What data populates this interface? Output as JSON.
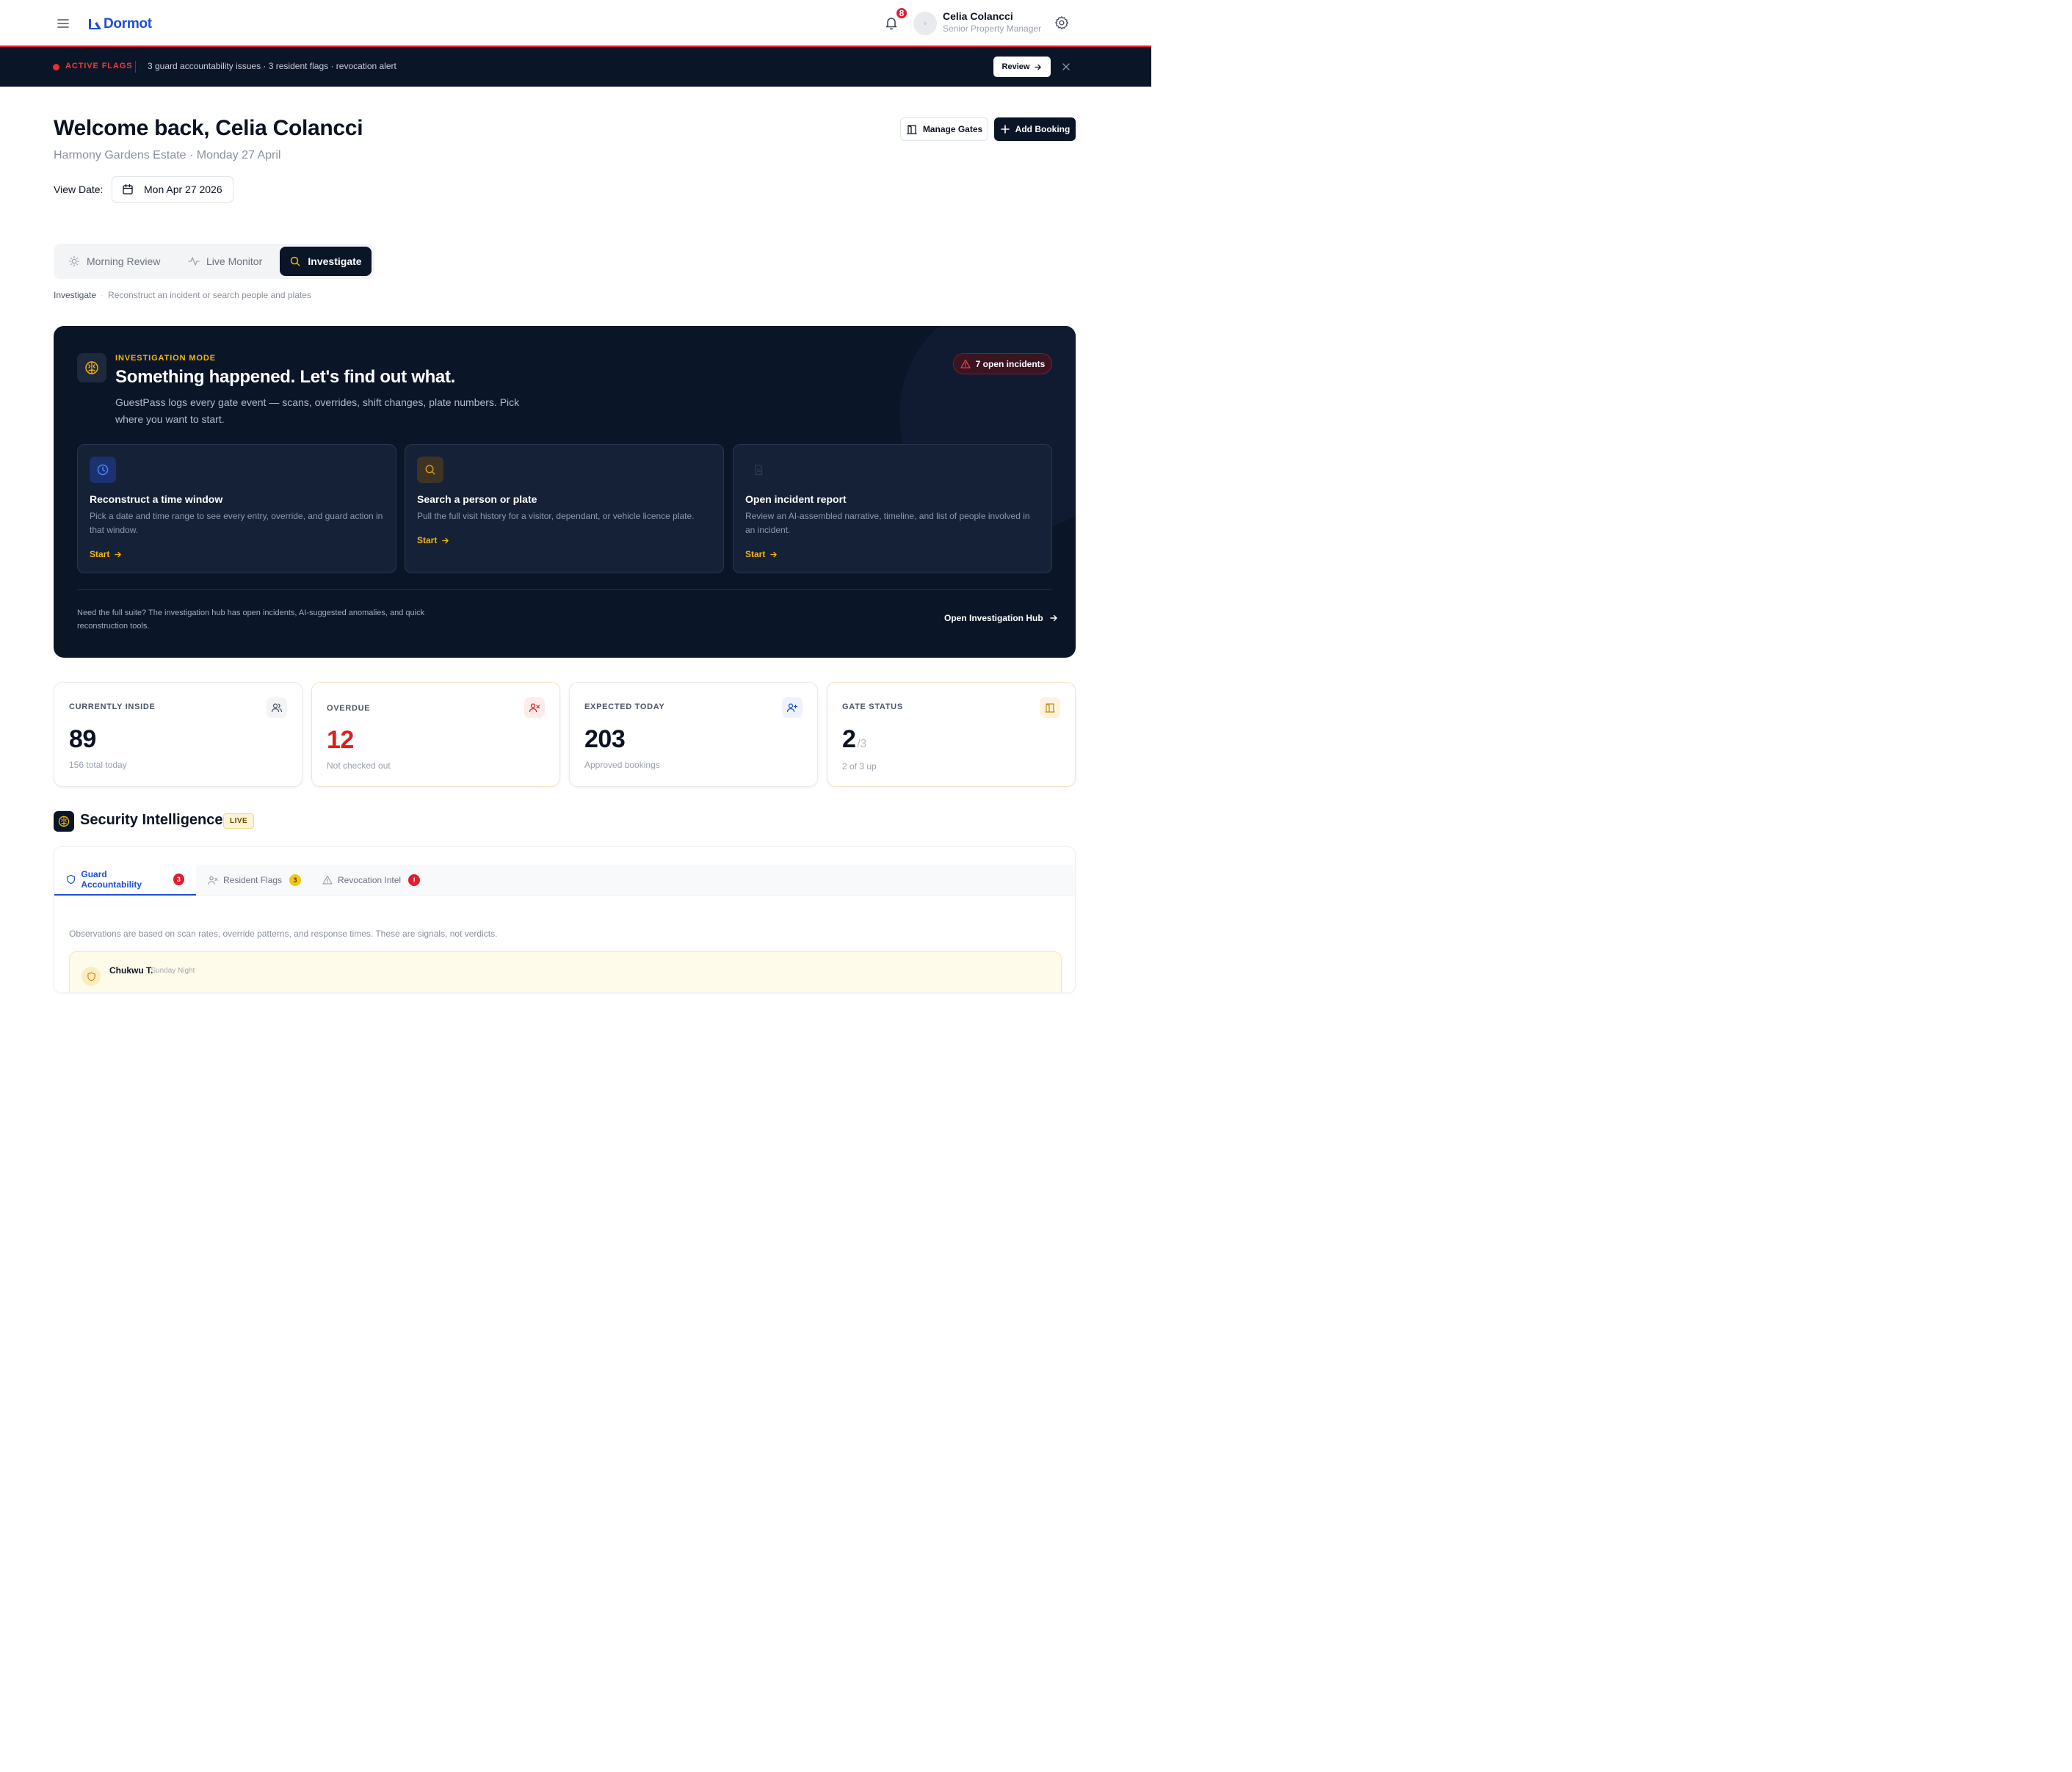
{
  "brand": {
    "name": "Dormot",
    "accent": "#1d4ed8"
  },
  "header": {
    "notification_count": "8",
    "user_name": "Celia Colancci",
    "user_role": "Senior Property Manager",
    "icons": [
      "menu-icon",
      "bell-icon",
      "avatar",
      "gear-icon"
    ]
  },
  "flags": {
    "label": "ACTIVE FLAGS",
    "summary": "3 guard accountability issues · 3 resident flags · revocation alert",
    "review_label": "Review",
    "color": "#ef2b2b"
  },
  "welcome": {
    "title": "Welcome back, Celia Colancci",
    "subtitle": "Harmony Gardens Estate · Monday 27 April",
    "manage_gates_label": "Manage Gates",
    "add_booking_label": "Add Booking",
    "view_date_label": "View Date:",
    "view_date_value": "Mon Apr 27 2026"
  },
  "modes": {
    "tabs": [
      {
        "label": "Morning Review",
        "icon": "sun-icon"
      },
      {
        "label": "Live Monitor",
        "icon": "activity-icon"
      },
      {
        "label": "Investigate",
        "icon": "search-icon",
        "active": true
      }
    ],
    "breadcrumb_current": "Investigate",
    "breadcrumb_hint": "Reconstruct an incident or search people and plates"
  },
  "investigation": {
    "kicker": "INVESTIGATION MODE",
    "title": "Something happened. Let's find out what.",
    "description": "GuestPass logs every gate event — scans, overrides, shift changes, plate numbers. Pick where you want to start.",
    "incidents_label": "7 open incidents",
    "cards": [
      {
        "title": "Reconstruct a time window",
        "description": "Pick a date and time range to see every entry, override, and guard action in that window.",
        "action": "Start",
        "icon": "clock-icon"
      },
      {
        "title": "Search a person or plate",
        "description": "Pull the full visit history for a visitor, dependant, or vehicle licence plate.",
        "action": "Start",
        "icon": "search-icon"
      },
      {
        "title": "Open incident report",
        "description": "Review an AI-assembled narrative, timeline, and list of people involved in an incident.",
        "action": "Start",
        "icon": "file-icon"
      }
    ],
    "footer_text": "Need the full suite? The investigation hub has open incidents, AI-suggested anomalies, and quick reconstruction tools.",
    "hub_link": "Open Investigation Hub",
    "accent": "#f5b50a"
  },
  "stats": [
    {
      "label": "CURRENTLY INSIDE",
      "value": "89",
      "sub": "156 total today",
      "icon": "users-icon"
    },
    {
      "label": "OVERDUE",
      "value": "12",
      "sub": "Not checked out",
      "icon": "user-x-icon",
      "color": "#e11d1d"
    },
    {
      "label": "EXPECTED TODAY",
      "value": "203",
      "sub": "Approved bookings",
      "icon": "user-plus-icon"
    },
    {
      "label": "GATE STATUS",
      "value": "2",
      "of": "/3",
      "sub": "2 of 3 up",
      "icon": "gate-icon"
    }
  ],
  "security": {
    "title": "Security Intelligence",
    "live_label": "LIVE",
    "tabs": [
      {
        "label": "Guard Accountability",
        "count": "3",
        "icon": "shield-icon"
      },
      {
        "label": "Resident Flags",
        "count": "3",
        "icon": "user-flag-icon"
      },
      {
        "label": "Revocation Intel",
        "count": "!",
        "icon": "warning-icon"
      }
    ],
    "note": "Observations are based on scan rates, override patterns, and response times. These are signals, not verdicts.",
    "observation": {
      "name": "Chukwu T.",
      "meta": "Sunday Night"
    }
  }
}
